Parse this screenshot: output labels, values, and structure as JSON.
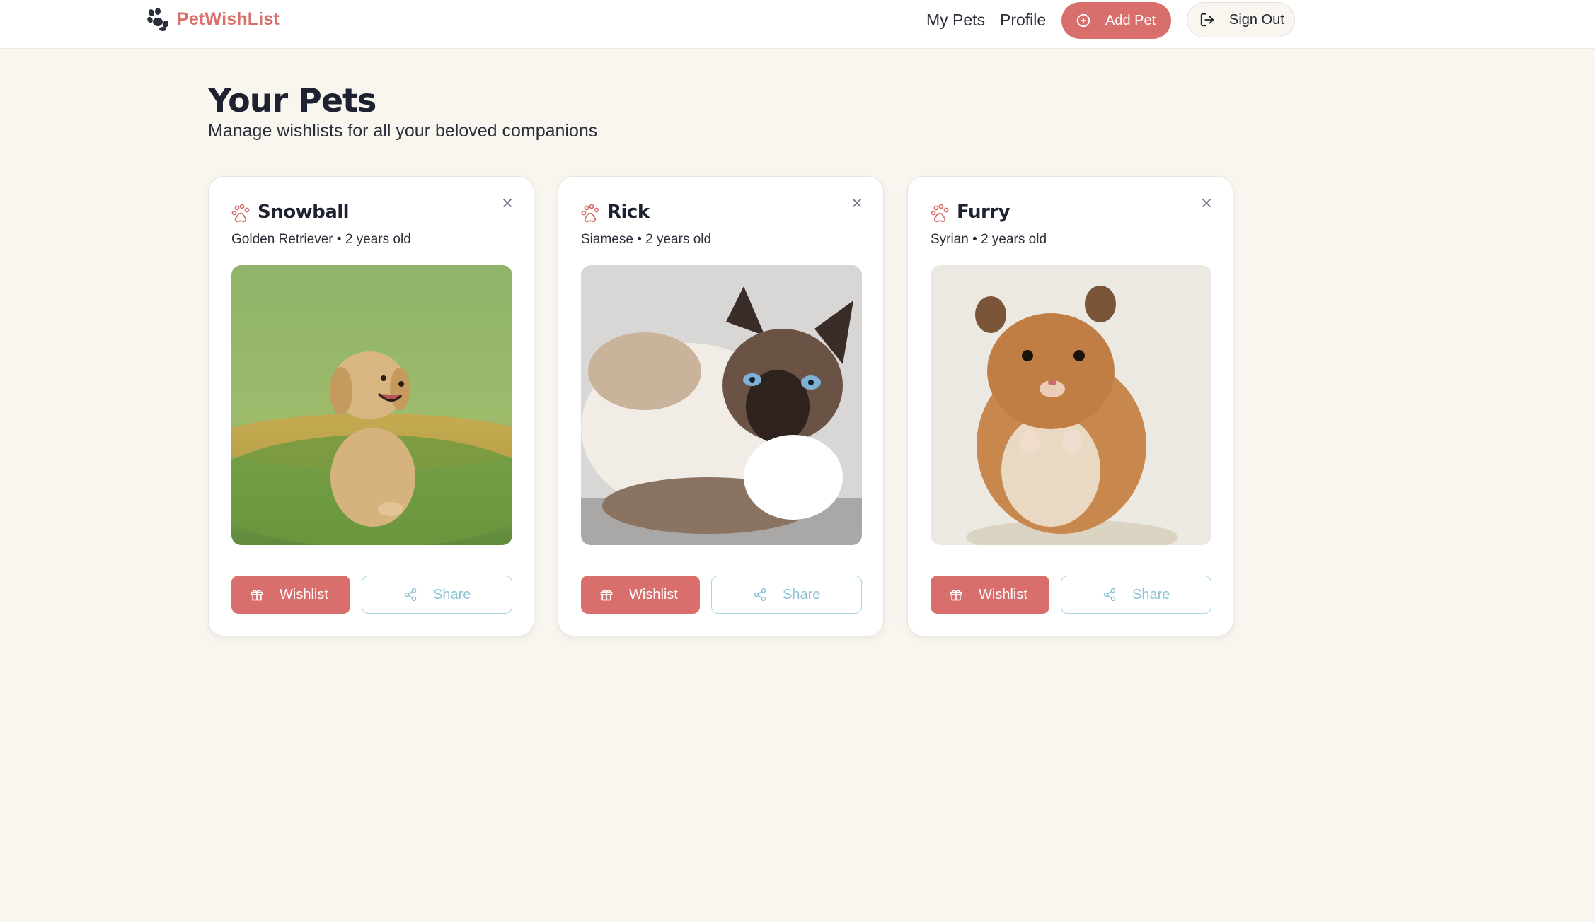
{
  "header": {
    "brand": "PetWishList",
    "nav": {
      "my_pets": "My Pets",
      "profile": "Profile"
    },
    "add_pet_label": "Add Pet",
    "sign_out_label": "Sign Out",
    "accent_color": "#d86f6c"
  },
  "main": {
    "title": "Your Pets",
    "subtitle": "Manage wishlists for all your beloved companions"
  },
  "pets": [
    {
      "name": "Snowball",
      "meta": "Golden Retriever • 2 years old",
      "wishlist_label": "Wishlist",
      "share_label": "Share",
      "photo": "golden-retriever-puppy-photo"
    },
    {
      "name": "Rick",
      "meta": "Siamese • 2 years old",
      "wishlist_label": "Wishlist",
      "share_label": "Share",
      "photo": "siamese-cat-photo"
    },
    {
      "name": "Furry",
      "meta": "Syrian • 2 years old",
      "wishlist_label": "Wishlist",
      "share_label": "Share",
      "photo": "syrian-hamster-photo"
    }
  ],
  "icons": [
    "paw-icon",
    "plus-circle-icon",
    "sign-out-icon",
    "close-icon",
    "gift-icon",
    "share-icon"
  ]
}
